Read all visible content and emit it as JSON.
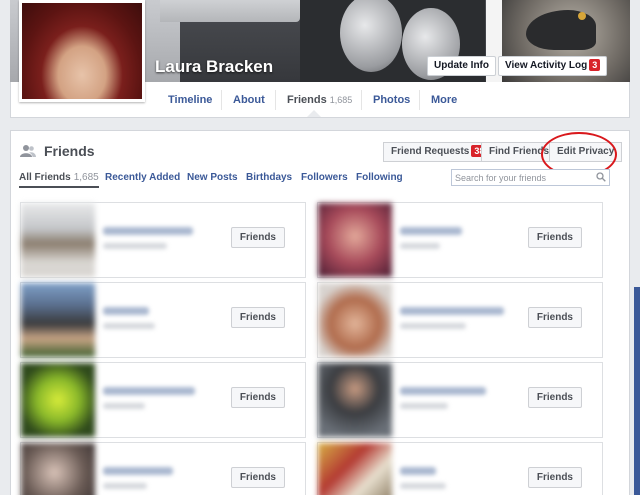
{
  "profile": {
    "name": "Laura Bracken",
    "update_info": "Update Info",
    "activity_log": "View Activity Log",
    "activity_badge": "3"
  },
  "nav": {
    "timeline": "Timeline",
    "about": "About",
    "friends": "Friends",
    "friends_count": "1,685",
    "photos": "Photos",
    "more": "More"
  },
  "friends_panel": {
    "title": "Friends",
    "friend_requests": "Friend Requests",
    "friend_requests_badge": "38",
    "find_friends": "Find Friends",
    "edit_privacy": "Edit Privacy",
    "tabs": {
      "all_friends": "All Friends",
      "all_count": "1,685",
      "recently_added": "Recently Added",
      "new_posts": "New Posts",
      "birthdays": "Birthdays",
      "followers": "Followers",
      "following": "Following"
    },
    "search_placeholder": "Search for your friends",
    "cards": [
      {
        "button": "Friends"
      },
      {
        "button": "Friends"
      },
      {
        "button": "Friends"
      },
      {
        "button": "Friends"
      },
      {
        "button": "Friends"
      },
      {
        "button": "Friends"
      },
      {
        "button": "Friends"
      },
      {
        "button": "Friends"
      }
    ]
  },
  "colors": {
    "link": "#3b5998",
    "badge_red": "#d8232a",
    "annotation_circle": "#d9181c"
  }
}
